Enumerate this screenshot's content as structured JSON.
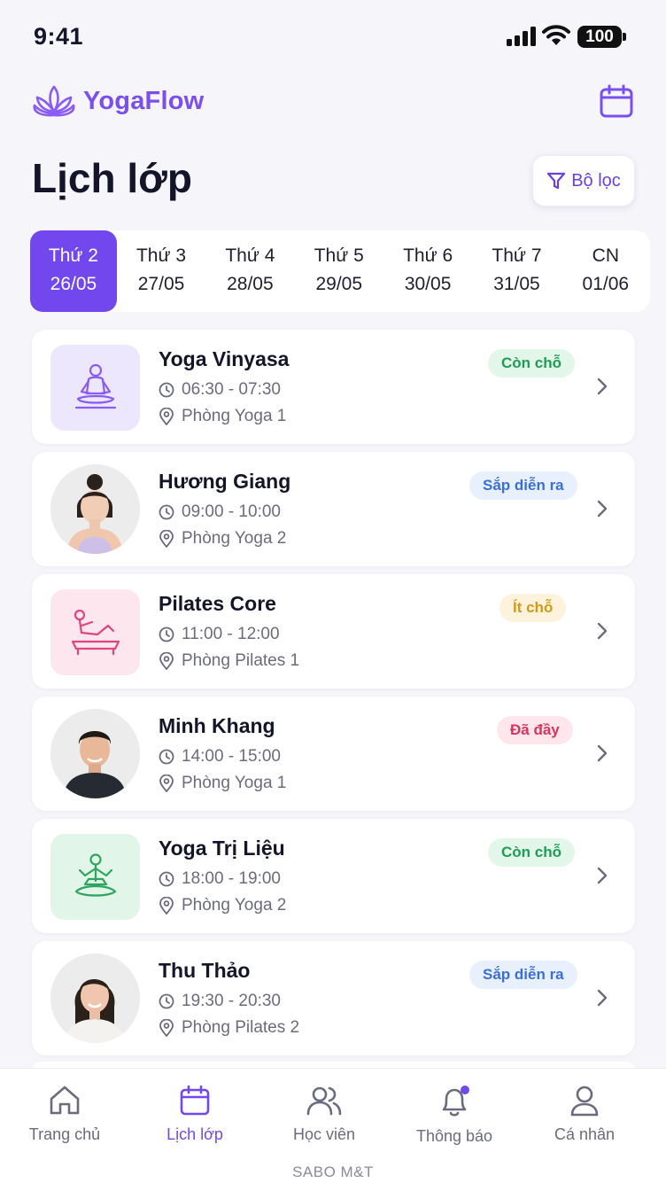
{
  "status_bar": {
    "time": "9:41",
    "battery": "100"
  },
  "header": {
    "brand": "YogaFlow",
    "title": "Lịch lớp",
    "filter_label": "Bộ lọc"
  },
  "days": [
    {
      "day": "Thứ 2",
      "date": "26/05",
      "active": true
    },
    {
      "day": "Thứ 3",
      "date": "27/05",
      "active": false
    },
    {
      "day": "Thứ 4",
      "date": "28/05",
      "active": false
    },
    {
      "day": "Thứ 5",
      "date": "29/05",
      "active": false
    },
    {
      "day": "Thứ 6",
      "date": "30/05",
      "active": false
    },
    {
      "day": "Thứ 7",
      "date": "31/05",
      "active": false
    },
    {
      "day": "CN",
      "date": "01/06",
      "active": false
    }
  ],
  "classes": [
    {
      "title": "Yoga Vinyasa",
      "time": "06:30 - 07:30",
      "room": "Phòng Yoga 1",
      "badge": "Còn chỗ",
      "thumb": "meditation-icon"
    },
    {
      "title": "Hương Giang",
      "time": "09:00 - 10:00",
      "room": "Phòng Yoga 2",
      "badge": "Sắp diễn ra",
      "thumb": "instructor-avatar"
    },
    {
      "title": "Pilates Core",
      "time": "11:00 - 12:00",
      "room": "Phòng Pilates 1",
      "badge": "Ít chỗ",
      "thumb": "pilates-reformer-icon"
    },
    {
      "title": "Minh Khang",
      "time": "14:00 - 15:00",
      "room": "Phòng Yoga 1",
      "badge": "Đã đầy",
      "thumb": "instructor-avatar"
    },
    {
      "title": "Yoga Trị Liệu",
      "time": "18:00 - 19:00",
      "room": "Phòng Yoga 2",
      "badge": "Còn chỗ",
      "thumb": "lotus-pose-icon"
    },
    {
      "title": "Thu Thảo",
      "time": "19:30 - 20:30",
      "room": "Phòng Pilates 2",
      "badge": "Sắp diễn ra",
      "thumb": "instructor-avatar"
    }
  ],
  "badge_colors": {
    "available": {
      "bg": "#e3f6ea",
      "fg": "#1f9d55"
    },
    "upcoming": {
      "bg": "#e8f0fd",
      "fg": "#3b6fd8"
    },
    "few": {
      "bg": "#fdf3dc",
      "fg": "#d49a12"
    },
    "full": {
      "bg": "#fde7ec",
      "fg": "#d8345f"
    }
  },
  "nav": [
    {
      "label": "Trang chủ",
      "icon": "home-icon"
    },
    {
      "label": "Lịch lớp",
      "icon": "calendar-icon",
      "active": true
    },
    {
      "label": "Học viên",
      "icon": "users-icon"
    },
    {
      "label": "Thông báo",
      "icon": "bell-icon"
    },
    {
      "label": "Cá nhân",
      "icon": "user-icon"
    }
  ],
  "footer": "SABO M&T",
  "accent": "#7347ee"
}
